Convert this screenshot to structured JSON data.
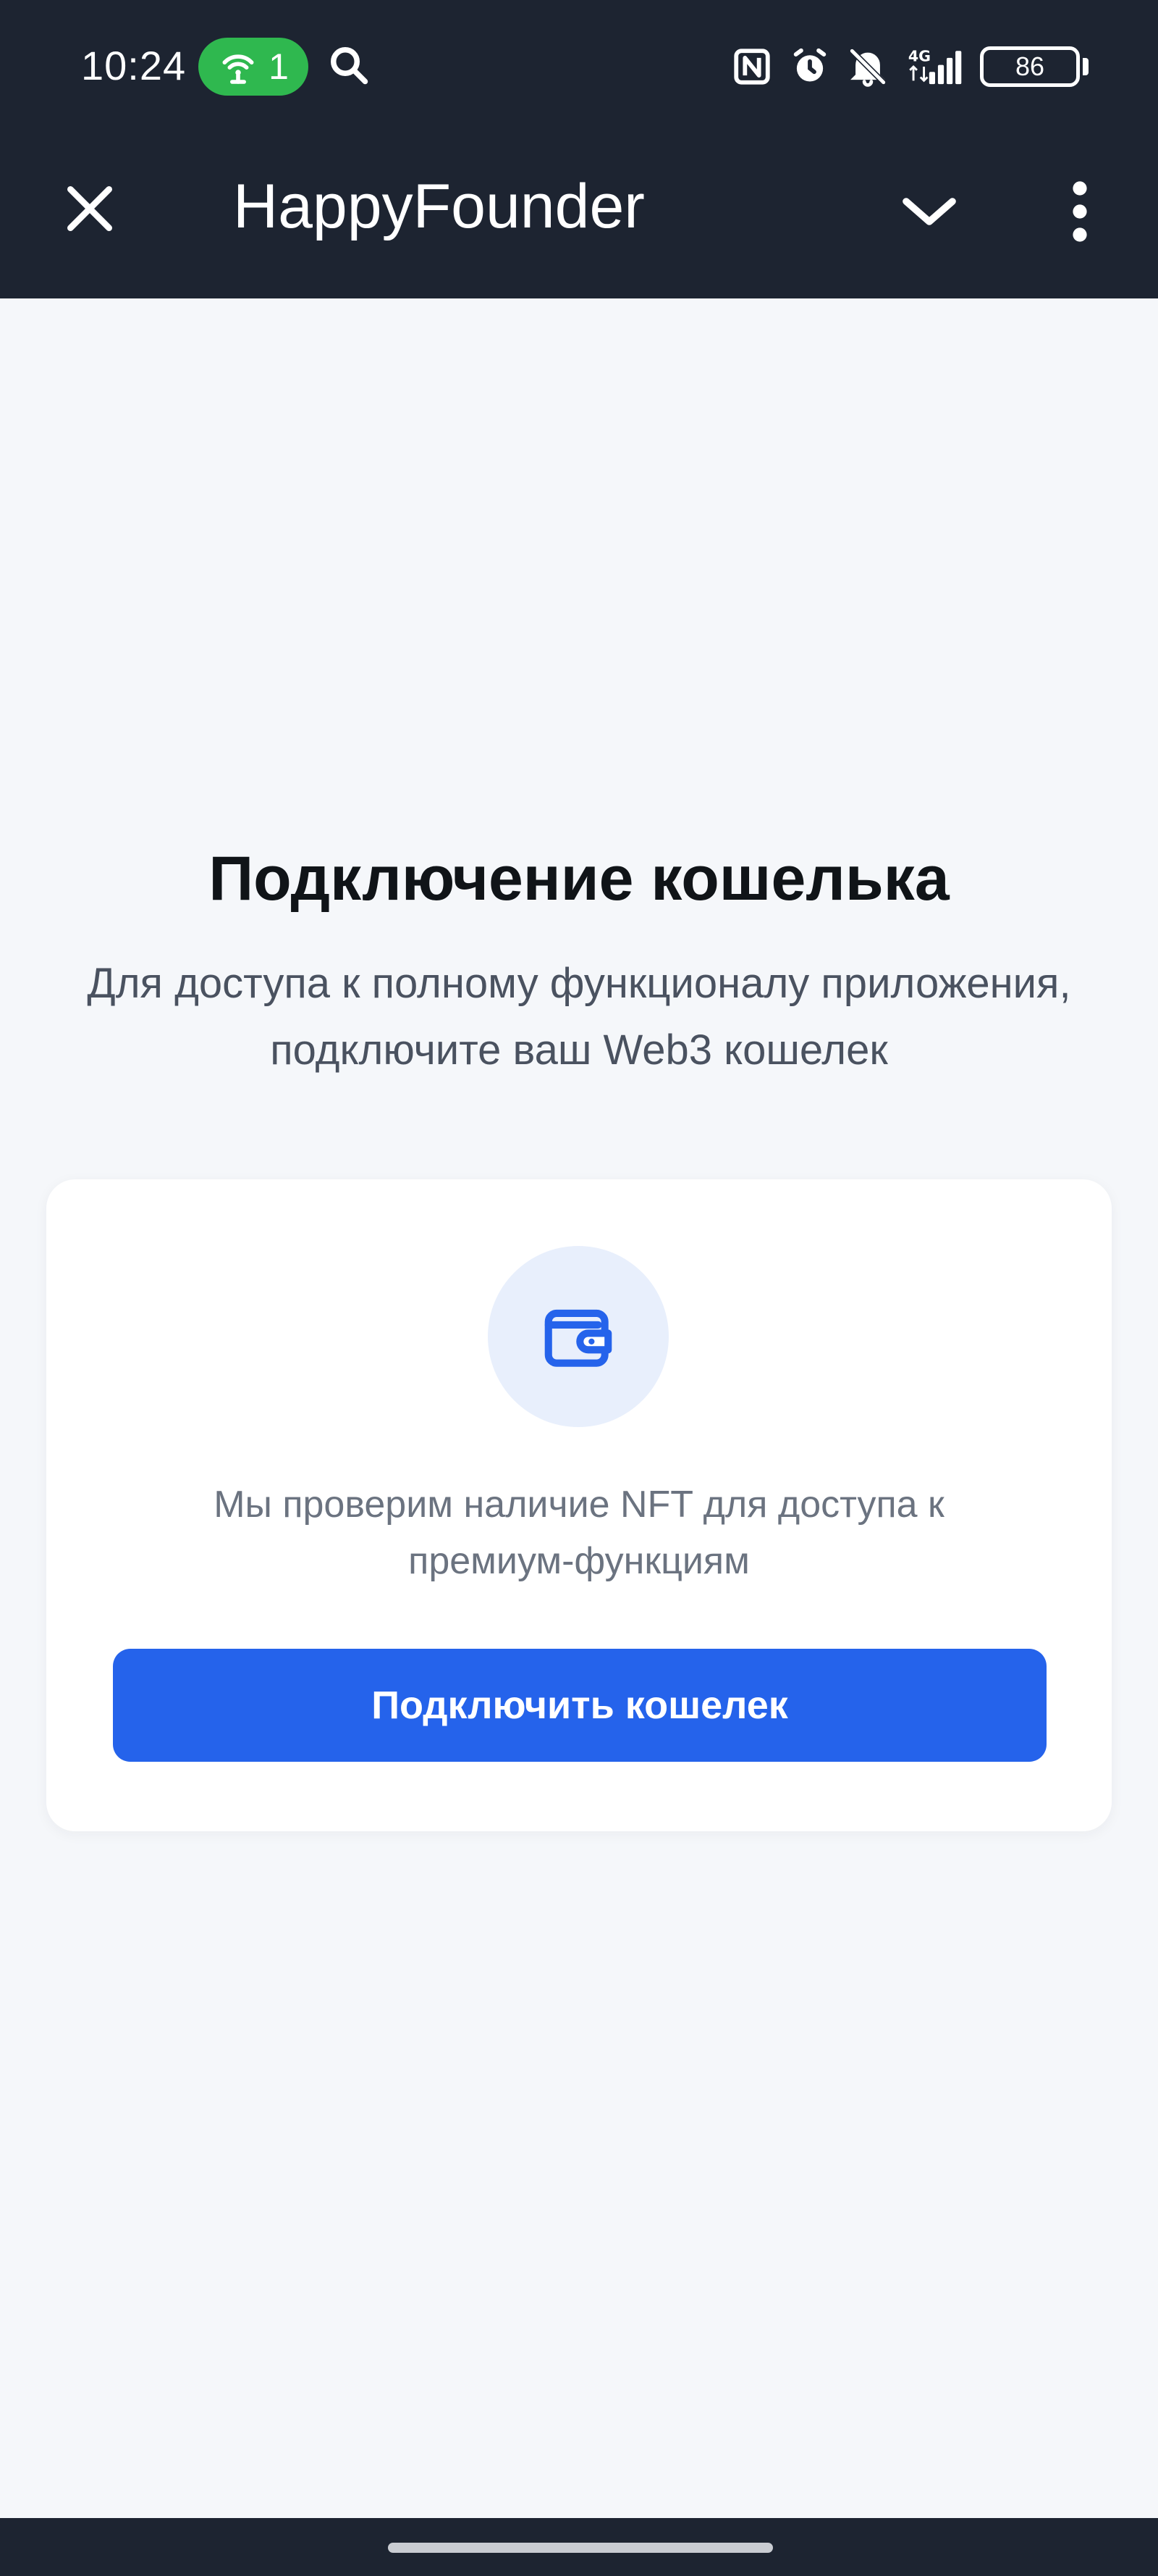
{
  "status_bar": {
    "time": "10:24",
    "hotspot_count": "1",
    "battery": "86",
    "icons": [
      "hotspot-icon",
      "search-icon",
      "nfc-icon",
      "alarm-icon",
      "bell-off-icon",
      "signal-4g-icon",
      "battery-icon"
    ]
  },
  "app_bar": {
    "title": "HappyFounder",
    "icons": [
      "close-icon",
      "chevron-down-icon",
      "more-vertical-icon"
    ]
  },
  "main": {
    "heading": "Подключение кошелька",
    "subtitle": "Для доступа к полному функционалу приложения, подключите ваш Web3 кошелек",
    "card": {
      "icon": "wallet-icon",
      "text": "Мы проверим наличие NFT для доступа к премиум-функциям",
      "button_label": "Подключить кошелек"
    }
  },
  "colors": {
    "topbar_bg": "#1d2431",
    "page_bg": "#f5f7fa",
    "accent": "#2563eb",
    "hotspot_pill": "#2fb84f"
  }
}
